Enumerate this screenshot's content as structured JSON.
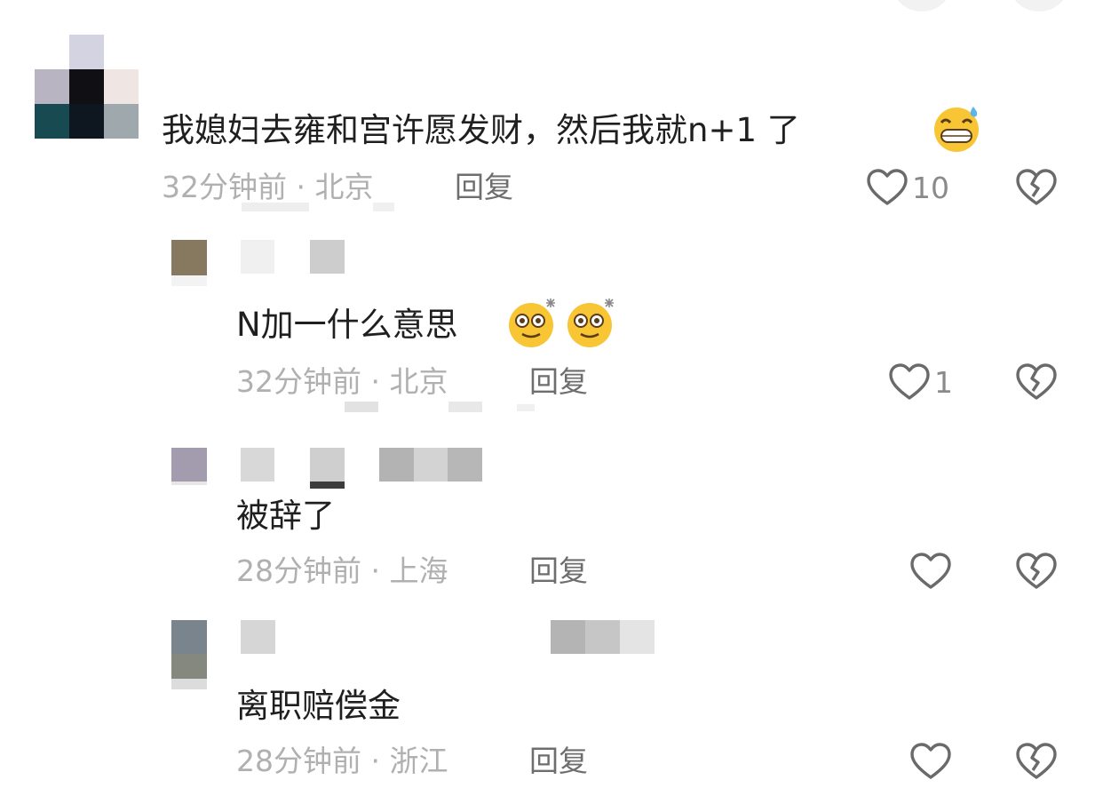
{
  "comments": [
    {
      "text": "我媳妇去雍和宫许愿发财，然后我就n+1 了",
      "time": "32分钟前",
      "location": "北京",
      "reply_label": "回复",
      "like_count": "10",
      "emoji": "grinning-sweat-emoji"
    },
    {
      "text": "N加一什么意思",
      "time": "32分钟前",
      "location": "北京",
      "reply_label": "回复",
      "like_count": "1",
      "emoji": "dizzy-face-emoji"
    },
    {
      "text": "被辞了",
      "time": "28分钟前",
      "location": "上海",
      "reply_label": "回复",
      "like_count": ""
    },
    {
      "text": "离职赔偿金",
      "time": "28分钟前",
      "location": "浙江",
      "reply_label": "回复",
      "like_count": ""
    }
  ],
  "meta_separator": " · ",
  "colors": {
    "meta_gray": "#b0b0b0",
    "reply_gray": "#6e6e6e",
    "icon_gray": "#6a6a6a",
    "text": "#1f1f1f"
  },
  "icons": [
    "heart-outline-icon",
    "broken-heart-icon"
  ]
}
